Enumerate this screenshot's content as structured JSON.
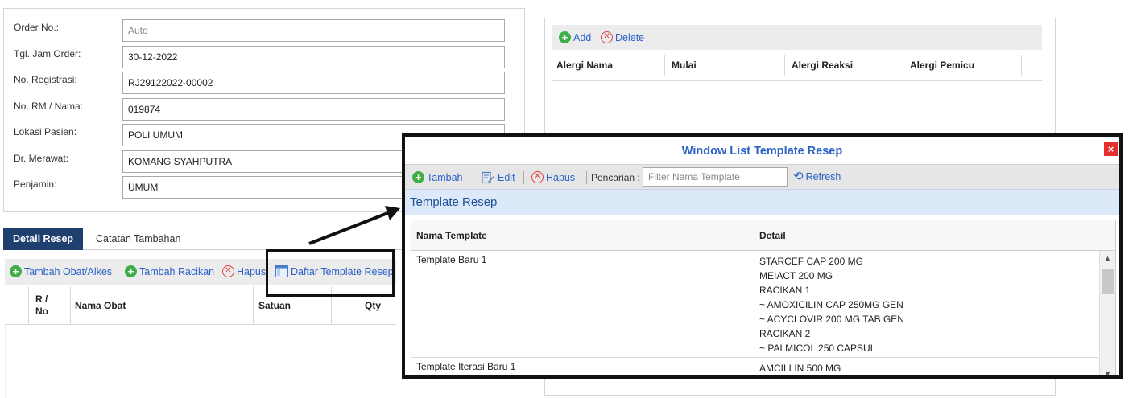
{
  "order_form": {
    "fields": [
      {
        "label": "Order No.:",
        "value": "Auto"
      },
      {
        "label": "Tgl. Jam Order:",
        "value": "30-12-2022"
      },
      {
        "label": "No. Registrasi:",
        "value": "RJ29122022-00002"
      },
      {
        "label": "No. RM / Nama:",
        "value": "019874"
      },
      {
        "label": "Lokasi Pasien:",
        "value": "POLI UMUM"
      },
      {
        "label": "Dr. Merawat:",
        "value": "KOMANG SYAHPUTRA"
      },
      {
        "label": "Penjamin:",
        "value": "UMUM"
      }
    ]
  },
  "allergy": {
    "toolbar": {
      "add": "Add",
      "delete": "Delete"
    },
    "columns": [
      "Alergi Nama",
      "Mulai",
      "Alergi Reaksi",
      "Alergi Pemicu"
    ]
  },
  "tabs": [
    {
      "label": "Detail Resep",
      "active": true
    },
    {
      "label": "Catatan Tambahan",
      "active": false
    }
  ],
  "recipe": {
    "toolbar": {
      "add_drug": "Tambah Obat/Alkes",
      "add_compound": "Tambah Racikan",
      "delete": "Hapus",
      "template_list": "Daftar Template Resep"
    },
    "columns": [
      "R /\nNo",
      "Nama Obat",
      "Satuan",
      "Qty"
    ]
  },
  "modal": {
    "title": "Window List Template Resep",
    "close": "×",
    "toolbar": {
      "add": "Tambah",
      "edit": "Edit",
      "delete": "Hapus",
      "search_label": "Pencarian :",
      "search_placeholder": "Filter Nama Template",
      "refresh": "Refresh"
    },
    "section_title": "Template Resep",
    "columns": [
      "Nama Template",
      "Detail"
    ],
    "rows": [
      {
        "name": "Template Baru 1",
        "details": [
          "STARCEF CAP 200 MG",
          "MEIACT 200 MG",
          "RACIKAN 1",
          "~ AMOXICILIN CAP 250MG GEN",
          "~ ACYCLOVIR 200 MG TAB GEN",
          "RACIKAN 2",
          "~ PALMICOL 250 CAPSUL"
        ]
      },
      {
        "name": "Template Iterasi Baru 1",
        "details": [
          "AMCILLIN 500 MG"
        ]
      }
    ]
  },
  "colors": {
    "link_blue": "#2a62c9",
    "tab_active": "#1f3f6e",
    "add_green": "#3fae49",
    "delete_red": "#e04040",
    "section_bg": "#dce9f8"
  }
}
